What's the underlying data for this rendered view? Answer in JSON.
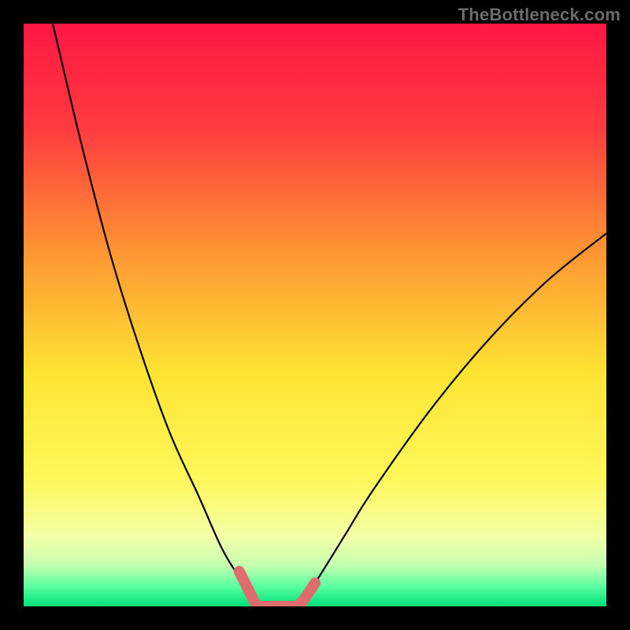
{
  "watermark": "TheBottleneck.com",
  "chart_data": {
    "type": "line",
    "title": "",
    "xlabel": "",
    "ylabel": "",
    "xlim": [
      0,
      100
    ],
    "ylim": [
      0,
      100
    ],
    "grid": false,
    "legend": false,
    "series": [
      {
        "name": "left-descending-curve",
        "x": [
          5,
          10,
          15,
          20,
          25,
          30,
          34,
          37,
          39,
          40
        ],
        "y": [
          100,
          79,
          60,
          44,
          30,
          19,
          10,
          5,
          2,
          0
        ]
      },
      {
        "name": "right-ascending-curve",
        "x": [
          47,
          50,
          55,
          60,
          70,
          80,
          90,
          100
        ],
        "y": [
          0,
          4,
          12,
          20,
          34,
          46,
          56,
          64
        ]
      },
      {
        "name": "highlighted-bottom-segment",
        "x": [
          37,
          39,
          40,
          44,
          47,
          48,
          50
        ],
        "y": [
          6,
          2,
          0,
          0,
          0,
          1,
          4
        ]
      }
    ],
    "gradient_bg": {
      "stops": [
        {
          "pos": 0.0,
          "color": "#ff1744"
        },
        {
          "pos": 0.18,
          "color": "#ff3b3f"
        },
        {
          "pos": 0.4,
          "color": "#ff9933"
        },
        {
          "pos": 0.6,
          "color": "#ffe433"
        },
        {
          "pos": 0.78,
          "color": "#fff85a"
        },
        {
          "pos": 0.88,
          "color": "#f4ffa8"
        },
        {
          "pos": 0.93,
          "color": "#c5ffb0"
        },
        {
          "pos": 0.965,
          "color": "#5bffa0"
        },
        {
          "pos": 1.0,
          "color": "#00e07a"
        }
      ]
    }
  }
}
